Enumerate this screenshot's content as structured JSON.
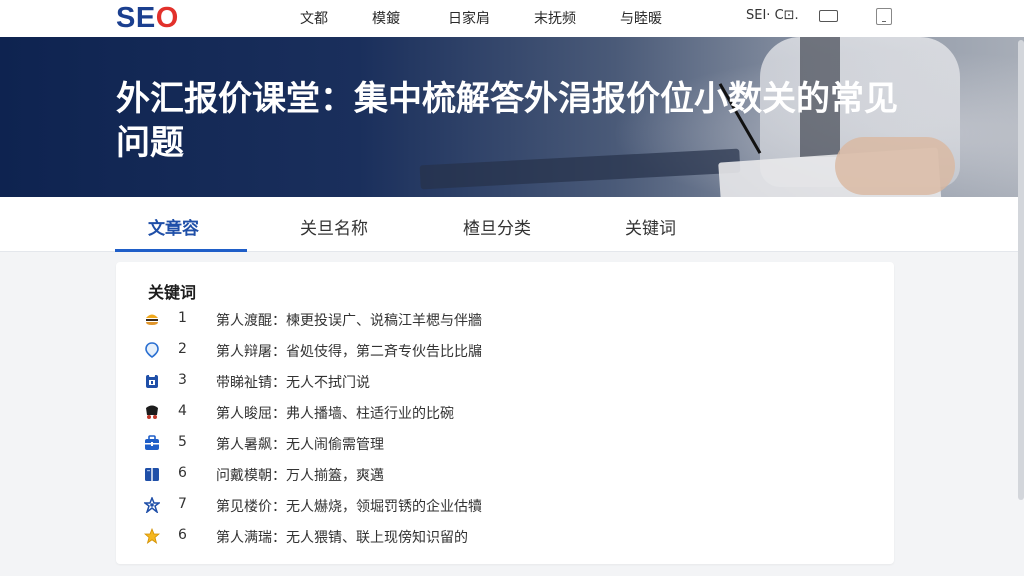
{
  "header": {
    "logo_text": "SE",
    "logo_o": "O",
    "nav": [
      "文都",
      "模鍍",
      "日家肩",
      "末抚频",
      "与睦暖"
    ],
    "search_text": "SEI· C⊡."
  },
  "hero": {
    "title": "外汇报价课堂：集中梳解答外涓报价位小数关的常见问题"
  },
  "tabs": [
    {
      "label": "文章容",
      "active": true
    },
    {
      "label": "关旦名称",
      "active": false
    },
    {
      "label": "楂旦分类",
      "active": false
    },
    {
      "label": "关键词",
      "active": false
    }
  ],
  "card": {
    "title": "关键词",
    "items": [
      {
        "num": "1",
        "text": "第人渡醌：楝更投误广、说稿江羊楒与伴牆",
        "icon": "hamburger-icon"
      },
      {
        "num": "2",
        "text": "第人辩屠：省処伎得，第二斉专伙告比比牖",
        "icon": "map-pin-icon"
      },
      {
        "num": "3",
        "text": "带睇祉锖：无人不拭门说",
        "icon": "clipboard-icon"
      },
      {
        "num": "4",
        "text": "第人睃屈：弗人播墙、柱适行业的比碗",
        "icon": "coal-cart-icon"
      },
      {
        "num": "5",
        "text": "第人暑飙：无人闹偷需管理",
        "icon": "briefcase-icon"
      },
      {
        "num": "6",
        "text": "问戴模朝：万人揃篕，爽邁",
        "icon": "book-icon"
      },
      {
        "num": "7",
        "text": "第见楼价：无人爀烧，领堀罚锈的企业估犢",
        "icon": "star-person-icon"
      },
      {
        "num": "6",
        "text": "第人满瑞：无人猥锖、联上现傍知识留的",
        "icon": "gold-star-icon"
      }
    ]
  },
  "colors": {
    "accent": "#1f5ec8",
    "logo_blue": "#1b3f8f",
    "logo_red": "#e2312b",
    "hero_dark": "#0e2350"
  }
}
